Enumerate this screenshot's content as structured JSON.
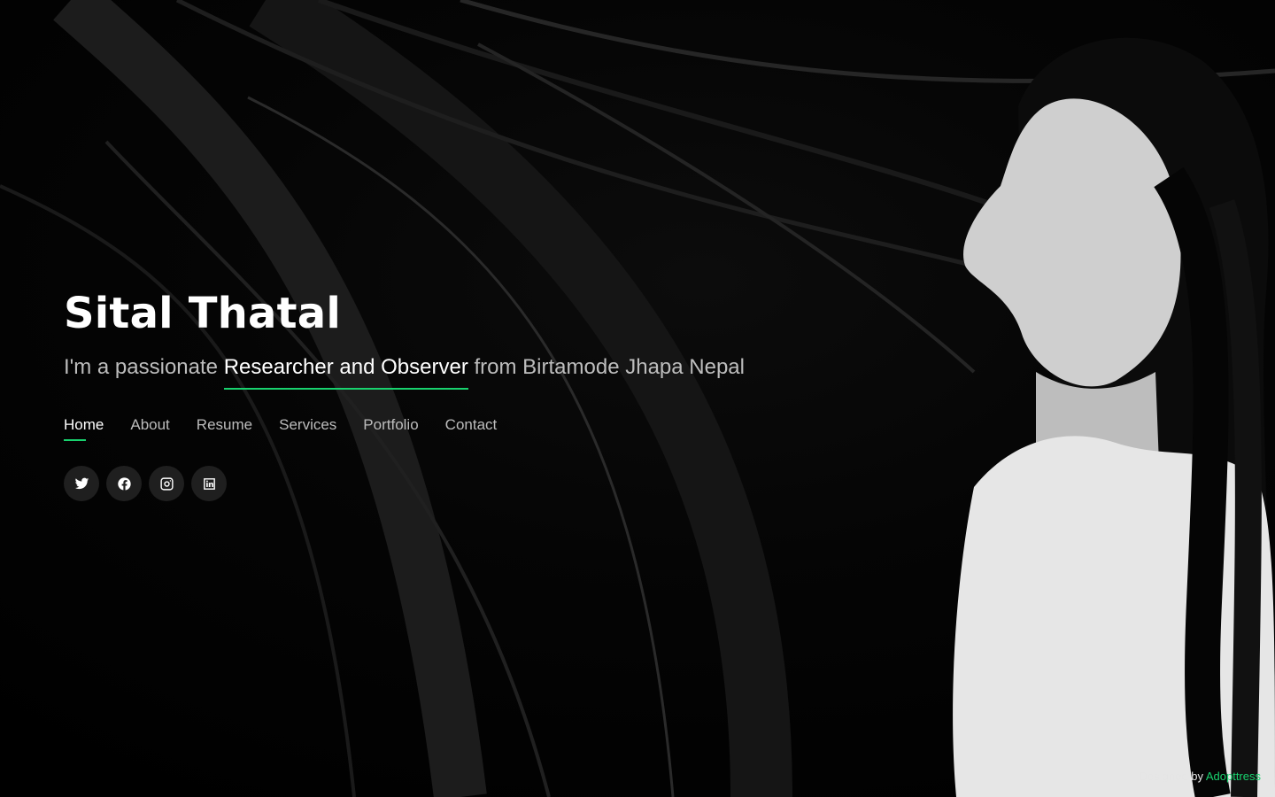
{
  "hero": {
    "name": "Sital Thatal",
    "subtitle_prefix": "I'm a passionate ",
    "subtitle_highlight": "Researcher and Observer",
    "subtitle_suffix": " from Birtamode Jhapa Nepal"
  },
  "nav": {
    "items": [
      {
        "label": "Home"
      },
      {
        "label": "About"
      },
      {
        "label": "Resume"
      },
      {
        "label": "Services"
      },
      {
        "label": "Portfolio"
      },
      {
        "label": "Contact"
      }
    ]
  },
  "social": {
    "icons": [
      "twitter-icon",
      "facebook-icon",
      "instagram-icon",
      "linkedin-icon"
    ]
  },
  "credits": {
    "prefix": "Designed by ",
    "link_label": "Adopttress"
  },
  "colors": {
    "accent": "#18d26e",
    "background": "#000000",
    "nav_text": "#bcbcbc"
  }
}
